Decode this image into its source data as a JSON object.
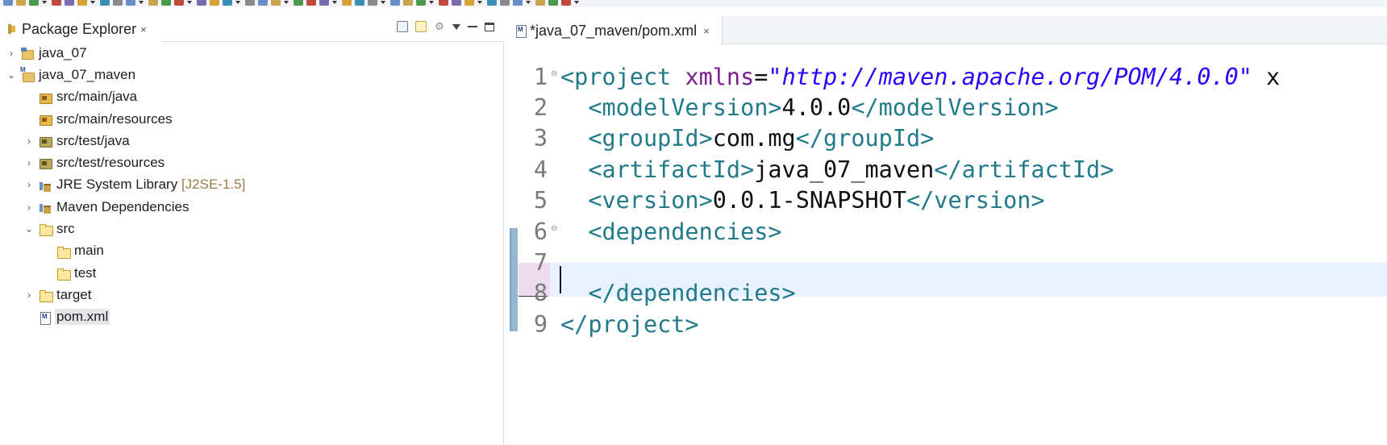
{
  "colors": {
    "tag": "#217a8a",
    "attr": "#7b1e8e",
    "attr_value": "#2a00ff",
    "current_line": "#e8f2fe",
    "selection_row": "#e4e6ea",
    "suffix": "#957d47"
  },
  "explorer": {
    "title": "Package Explorer",
    "close_icon": "×",
    "tree": [
      {
        "label": "java_07",
        "suffix": "",
        "twisty": "›",
        "icon": "project-icon",
        "depth": 0
      },
      {
        "label": "java_07_maven",
        "suffix": "",
        "twisty": "⌄",
        "icon": "maven-project-icon",
        "depth": 0
      },
      {
        "label": "src/main/java",
        "suffix": "",
        "twisty": "",
        "icon": "source-folder-icon",
        "depth": 1
      },
      {
        "label": "src/main/resources",
        "suffix": "",
        "twisty": "",
        "icon": "source-folder-icon",
        "depth": 1
      },
      {
        "label": "src/test/java",
        "suffix": "",
        "twisty": "›",
        "icon": "test-source-folder-icon",
        "depth": 1
      },
      {
        "label": "src/test/resources",
        "suffix": "",
        "twisty": "›",
        "icon": "test-source-folder-icon",
        "depth": 1
      },
      {
        "label": "JRE System Library",
        "suffix": "[J2SE-1.5]",
        "twisty": "›",
        "icon": "library-icon",
        "depth": 1
      },
      {
        "label": "Maven Dependencies",
        "suffix": "",
        "twisty": "›",
        "icon": "library-icon",
        "depth": 1
      },
      {
        "label": "src",
        "suffix": "",
        "twisty": "⌄",
        "icon": "folder-icon",
        "depth": 1
      },
      {
        "label": "main",
        "suffix": "",
        "twisty": "",
        "icon": "folder-icon",
        "depth": 2
      },
      {
        "label": "test",
        "suffix": "",
        "twisty": "",
        "icon": "folder-icon",
        "depth": 2
      },
      {
        "label": "target",
        "suffix": "",
        "twisty": "›",
        "icon": "folder-icon",
        "depth": 1
      },
      {
        "label": "pom.xml",
        "suffix": "",
        "twisty": "",
        "icon": "xml-file-icon",
        "depth": 1,
        "selected": true
      }
    ]
  },
  "editor": {
    "tab_title": "*java_07_maven/pom.xml",
    "close_icon": "×",
    "current_line": 7,
    "lines": [
      {
        "num": "1",
        "fold": true,
        "tokens": [
          [
            "tag",
            "<project "
          ],
          [
            "attr",
            "xmlns"
          ],
          [
            "plain",
            "="
          ],
          [
            "attr-val",
            "\"http://maven.apache.org/POM/4.0.0\""
          ],
          [
            "plain",
            " x"
          ]
        ]
      },
      {
        "num": "2",
        "fold": false,
        "tokens": [
          [
            "plain",
            "  "
          ],
          [
            "tag",
            "<modelVersion>"
          ],
          [
            "plain",
            "4.0.0"
          ],
          [
            "tag",
            "</modelVersion>"
          ]
        ]
      },
      {
        "num": "3",
        "fold": false,
        "tokens": [
          [
            "plain",
            "  "
          ],
          [
            "tag",
            "<groupId>"
          ],
          [
            "plain",
            "com.mg"
          ],
          [
            "tag",
            "</groupId>"
          ]
        ]
      },
      {
        "num": "4",
        "fold": false,
        "tokens": [
          [
            "plain",
            "  "
          ],
          [
            "tag",
            "<artifactId>"
          ],
          [
            "plain",
            "java_07_maven"
          ],
          [
            "tag",
            "</artifactId>"
          ]
        ]
      },
      {
        "num": "5",
        "fold": false,
        "tokens": [
          [
            "plain",
            "  "
          ],
          [
            "tag",
            "<version>"
          ],
          [
            "plain",
            "0.0.1-SNAPSHOT"
          ],
          [
            "tag",
            "</version>"
          ]
        ]
      },
      {
        "num": "6",
        "fold": true,
        "tokens": [
          [
            "plain",
            "  "
          ],
          [
            "tag",
            "<dependencies>"
          ]
        ]
      },
      {
        "num": "7",
        "fold": false,
        "tokens": []
      },
      {
        "num": "8",
        "fold": false,
        "tokens": [
          [
            "plain",
            "  "
          ],
          [
            "tag",
            "</dependencies>"
          ]
        ]
      },
      {
        "num": "9",
        "fold": false,
        "tokens": [
          [
            "tag",
            "</project>"
          ]
        ]
      }
    ]
  }
}
